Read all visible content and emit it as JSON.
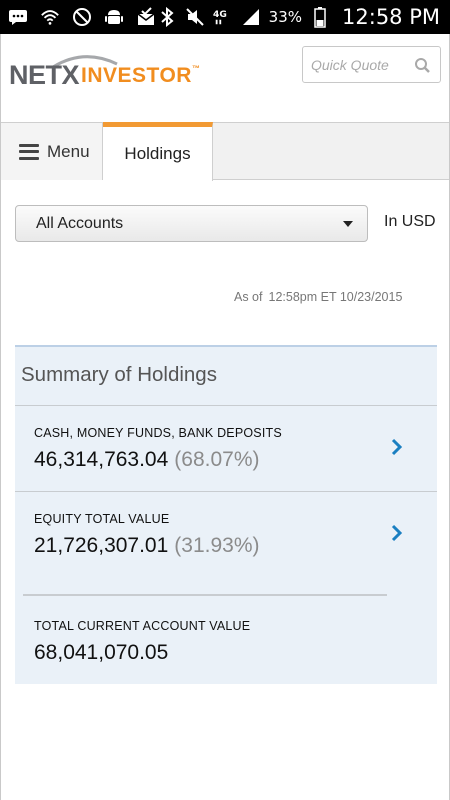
{
  "status_bar": {
    "battery": "33%",
    "time": "12:58 PM",
    "network": "4G"
  },
  "app": {
    "logo": {
      "part1": "NETX",
      "part2": "INVESTOR",
      "trademark": "™"
    },
    "search": {
      "placeholder": "Quick Quote"
    }
  },
  "tabs": {
    "menu_label": "Menu",
    "holdings_label": "Holdings"
  },
  "accounts": {
    "selected": "All Accounts",
    "currency": "In USD"
  },
  "as_of": {
    "prefix": "As of",
    "timestamp": "12:58pm ET 10/23/2015"
  },
  "summary": {
    "title": "Summary of Holdings",
    "rows": [
      {
        "label": "CASH, MONEY FUNDS, BANK DEPOSITS",
        "value": "46,314,763.04",
        "percent": "(68.07%)"
      },
      {
        "label": "EQUITY TOTAL VALUE",
        "value": "21,726,307.01",
        "percent": "(31.93%)"
      }
    ],
    "total": {
      "label": "TOTAL CURRENT ACCOUNT VALUE",
      "value": "68,041,070.05"
    }
  },
  "colors": {
    "accent_orange": "#f29a33",
    "logo_gray": "#5f6166",
    "chevron_blue": "#1a7fc1",
    "panel_bg": "#eaf1f8"
  }
}
